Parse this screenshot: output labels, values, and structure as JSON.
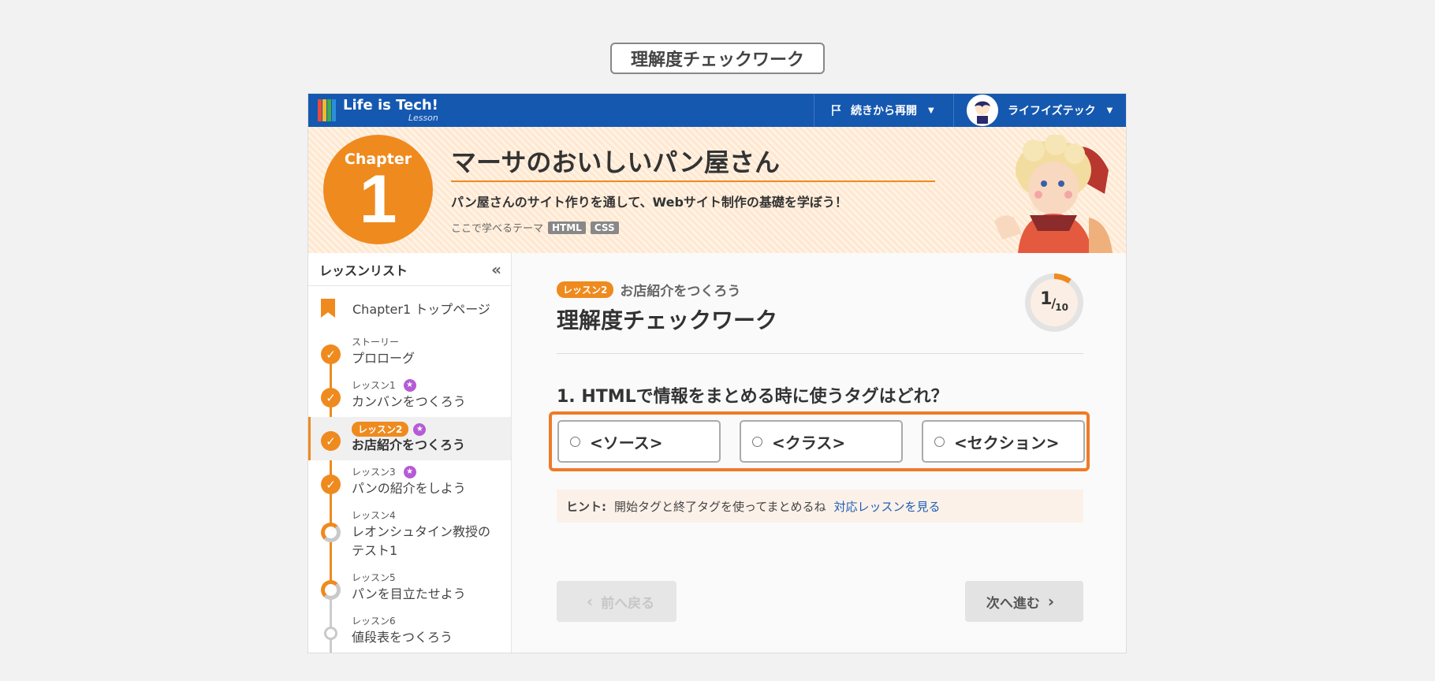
{
  "page_label": "理解度チェックワーク",
  "header": {
    "logo_title": "Life is Tech!",
    "logo_sub": "Lesson",
    "resume_label": "続きから再開",
    "user_name": "ライフイズテック"
  },
  "banner": {
    "chapter_word": "Chapter",
    "chapter_number": "1",
    "title": "マーサのおいしいパン屋さん",
    "description": "パン屋さんのサイト作りを通して、Webサイト制作の基礎を学ぼう！",
    "theme_label": "ここで学べるテーマ",
    "tags": [
      "HTML",
      "CSS"
    ]
  },
  "sidebar": {
    "heading": "レッスンリスト",
    "collapse_icon": "«",
    "top_page": "Chapter1 トップページ",
    "lessons": [
      {
        "kicker": "ストーリー",
        "title": "プロローグ",
        "status": "done"
      },
      {
        "kicker": "レッスン1",
        "title": "カンバンをつくろう",
        "status": "done",
        "star": true
      },
      {
        "kicker": "レッスン2",
        "title": "お店紹介をつくろう",
        "status": "done",
        "star": true,
        "active": true
      },
      {
        "kicker": "レッスン3",
        "title": "パンの紹介をしよう",
        "status": "done",
        "star": true
      },
      {
        "kicker": "レッスン4",
        "title": "レオンシュタイン教授のテスト1",
        "status": "in-progress"
      },
      {
        "kicker": "レッスン5",
        "title": "パンを目立たせよう",
        "status": "in-progress"
      },
      {
        "kicker": "レッスン6",
        "title": "値段表をつくろう",
        "status": "not-started"
      }
    ]
  },
  "main": {
    "lesson_pill": "レッスン2",
    "lesson_name": "お店紹介をつくろう",
    "title": "理解度チェックワーク",
    "progress_current": "1",
    "progress_total": "10",
    "progress_fraction": 0.1,
    "question": "1. HTMLで情報をまとめる時に使うタグはどれ？",
    "answers": [
      "<ソース>",
      "<クラス>",
      "<セクション>"
    ],
    "hint_label": "ヒント:",
    "hint_text": "開始タグと終了タグを使ってまとめるね",
    "hint_link": "対応レッスンを見る",
    "prev_label": "前へ戻る",
    "next_label": "次へ進む"
  },
  "colors": {
    "brand_blue": "#1558b0",
    "accent_orange": "#ef8a1e",
    "star_purple": "#b55bd6",
    "link_blue": "#1c5fb5"
  }
}
